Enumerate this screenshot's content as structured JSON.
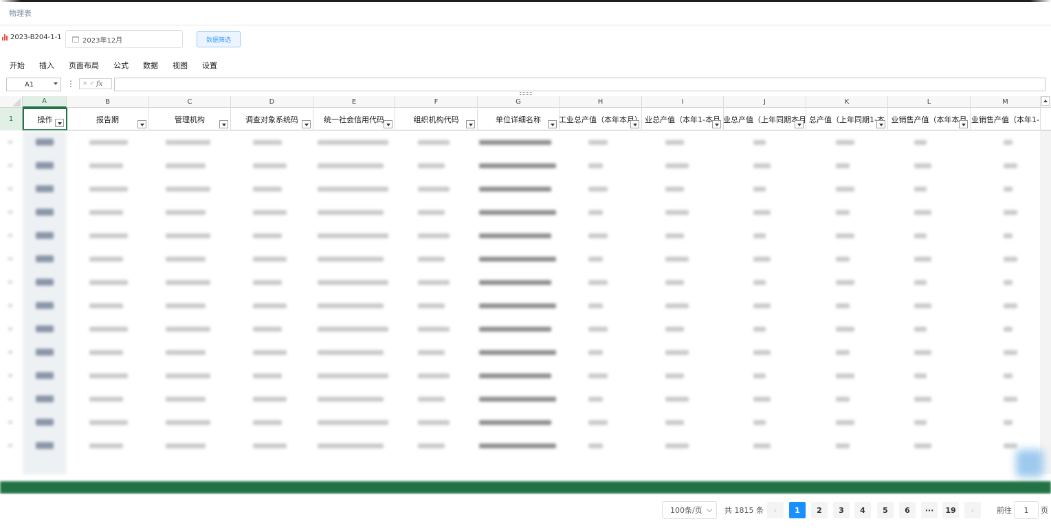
{
  "page": {
    "title": "物理表"
  },
  "filters": {
    "report_code": "2023-B204-1-1",
    "period": "2023年12月",
    "filter_button": "数据筛选",
    "icon_report": "bar-chart-icon",
    "icon_period": "calendar-icon"
  },
  "menu": [
    "开始",
    "插入",
    "页面布局",
    "公式",
    "数据",
    "视图",
    "设置"
  ],
  "formula_bar": {
    "cell_ref": "A1",
    "more": "⋮",
    "cancel_confirm": "× ✓",
    "fx": "fx",
    "content": ""
  },
  "sheet": {
    "columns": [
      "A",
      "B",
      "C",
      "D",
      "E",
      "F",
      "G",
      "H",
      "I",
      "J",
      "K",
      "L",
      "M"
    ],
    "active_column": "A",
    "header_row_number": "1",
    "headers": [
      "操作",
      "报告期",
      "管理机构",
      "调查对象系统码",
      "统一社会信用代码",
      "组织机构代码",
      "单位详细名称",
      "工业总产值（本年本月）",
      "业总产值（本年1-本月",
      "业总产值（上年同期本月",
      "总产值（上年同期1-本",
      "业销售产值（本年本月",
      "业销售产值（本年1-"
    ],
    "visible_data_rows": 14
  },
  "colors": {
    "accent_green": "#217346",
    "pager_active": "#1890ff",
    "filter_button": "#409eff"
  },
  "pagination": {
    "page_size": "100条/页",
    "total": "共 1815 条",
    "prev": "‹",
    "pages": [
      "1",
      "2",
      "3",
      "4",
      "5",
      "6"
    ],
    "ellipsis": "···",
    "last_page": "19",
    "next": "›",
    "current": "1",
    "goto_label": "前往",
    "goto_value": "1",
    "goto_suffix": "页"
  }
}
